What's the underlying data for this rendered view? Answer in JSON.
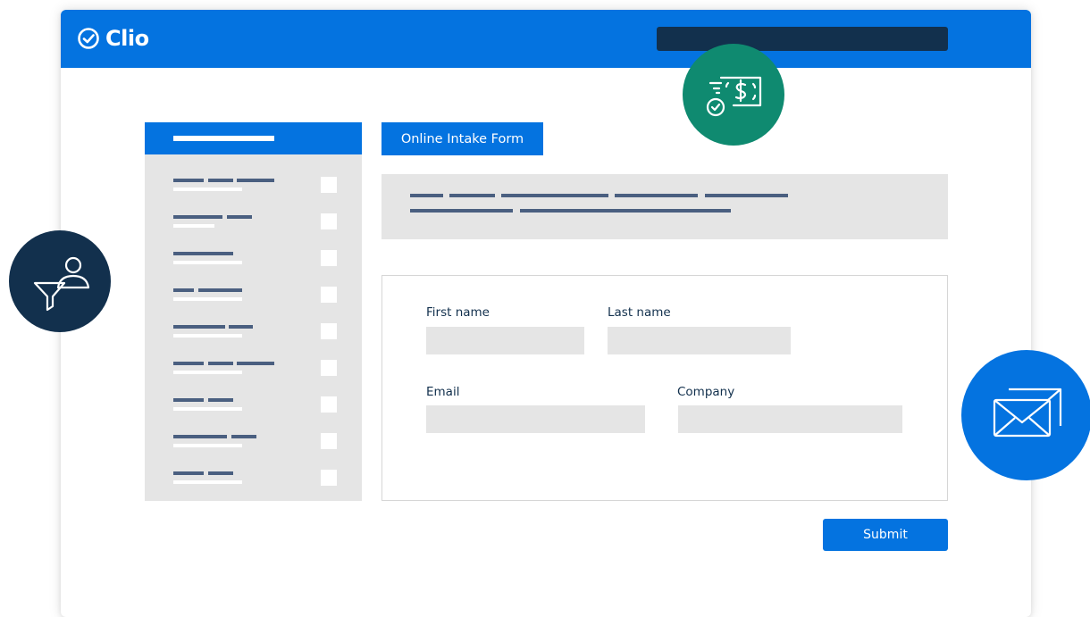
{
  "brand": {
    "name": "Clio"
  },
  "form": {
    "tab_label": "Online Intake Form",
    "fields": {
      "first_name": {
        "label": "First name",
        "value": ""
      },
      "last_name": {
        "label": "Last name",
        "value": ""
      },
      "email": {
        "label": "Email",
        "value": ""
      },
      "company": {
        "label": "Company",
        "value": ""
      }
    },
    "submit_label": "Submit"
  },
  "icons": {
    "logo": "check-circle-icon",
    "payment": "money-check-icon",
    "filter": "person-filter-icon",
    "email": "envelopes-icon"
  },
  "colors": {
    "brand_blue": "#0473e0",
    "navy": "#12304d",
    "teal": "#0f8a70",
    "placeholder_gray": "#e5e5e5",
    "text_bar": "#4a5f80"
  }
}
